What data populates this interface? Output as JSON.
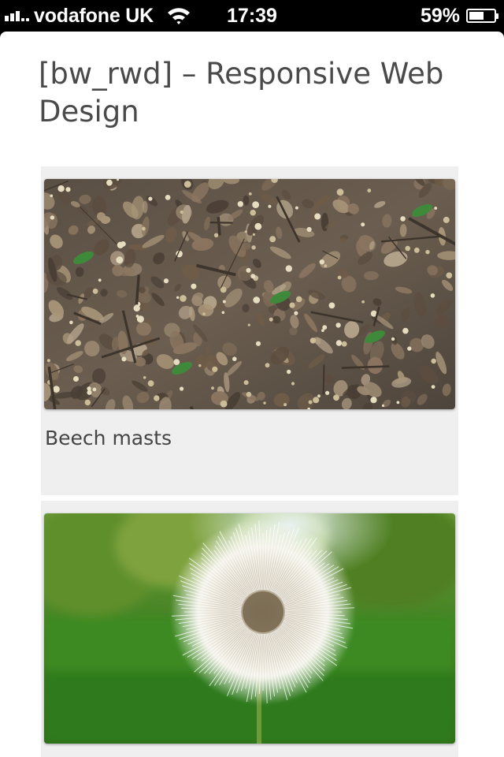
{
  "status_bar": {
    "carrier": "vodafone UK",
    "time": "17:39",
    "battery_percent": "59%",
    "battery_level": 0.59,
    "signal_bars": 3,
    "icons": [
      "signal-icon",
      "wifi-icon",
      "battery-icon"
    ]
  },
  "site": {
    "title": "[bw_rwd] – Responsive Web Design"
  },
  "gallery": {
    "items": [
      {
        "caption": "Beech masts",
        "image": "forest floor with beech masts, dry leaves and twigs"
      },
      {
        "caption": "",
        "image": "dandelion seed head in green grass"
      }
    ]
  },
  "colors": {
    "title_text": "#4a4a4a",
    "card_background": "#efefef",
    "status_bar_background": "#000000"
  }
}
